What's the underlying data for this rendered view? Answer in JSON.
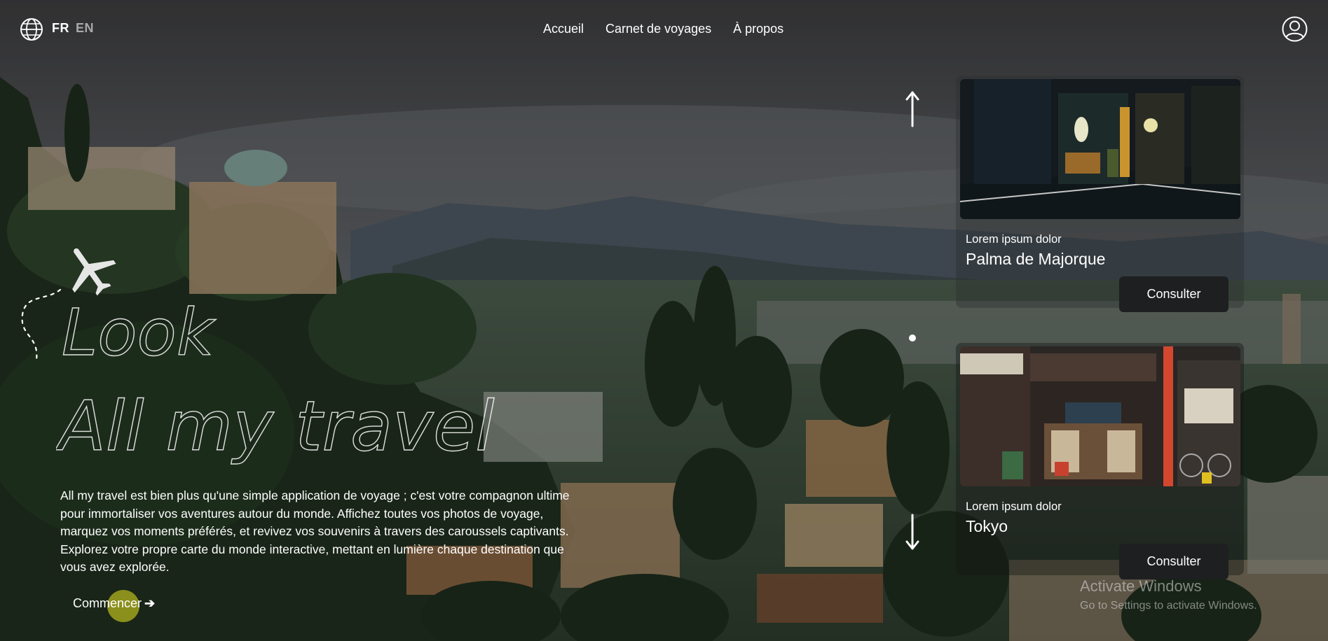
{
  "lang": {
    "active": "FR",
    "other": "EN"
  },
  "nav": {
    "items": [
      "Accueil",
      "Carnet de voyages",
      "À propos"
    ]
  },
  "icons": {
    "globe": "globe-icon",
    "user": "user-account-icon",
    "plane": "airplane-icon",
    "up": "arrow-up-icon",
    "down": "arrow-down-icon"
  },
  "hero": {
    "title_line1": "Look",
    "title_line2": "All my travel",
    "description": "All my travel est bien plus qu'une simple application de voyage ; c'est votre compagnon ultime pour immortaliser vos aventures autour du monde. Affichez toutes vos photos de voyage, marquez vos moments préférés, et revivez vos souvenirs à travers des caroussels captivants. Explorez votre propre carte du monde interactive, mettant en lumière chaque destination que vous avez explorée.",
    "cta_label": "Commencer",
    "cta_accent": "#8b8f1c"
  },
  "cards": [
    {
      "kicker": "Lorem ipsum dolor",
      "title": "Palma de Majorque",
      "button": "Consulter"
    },
    {
      "kicker": "Lorem ipsum dolor",
      "title": "Tokyo",
      "button": "Consulter"
    }
  ],
  "watermark": {
    "line1": "Activate Windows",
    "line2": "Go to Settings to activate Windows."
  }
}
